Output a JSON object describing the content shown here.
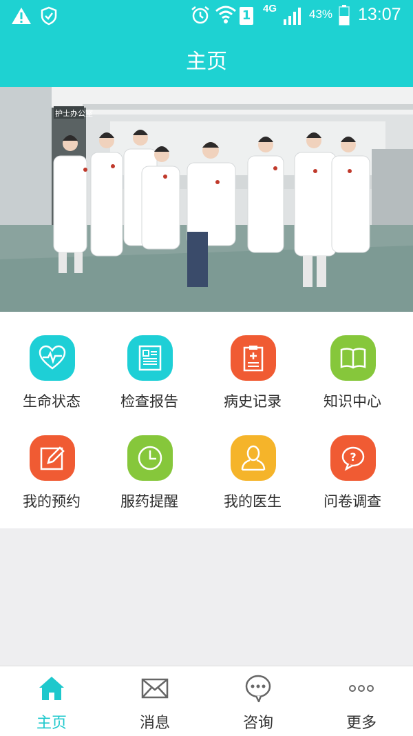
{
  "status_bar": {
    "network": "4G",
    "sim": "1",
    "battery": "43%",
    "time": "13:07",
    "icons": [
      "warning-icon",
      "shield-icon",
      "alarm-icon",
      "wifi-icon",
      "sim-icon",
      "signal-icon",
      "battery-icon"
    ]
  },
  "header": {
    "title": "主页"
  },
  "banner": {
    "description_icon": "team-photo",
    "sign_text": "护士办公室"
  },
  "grid": {
    "items": [
      {
        "label": "生命状态",
        "icon": "heartbeat-icon",
        "color": "#1ecfd6"
      },
      {
        "label": "检查报告",
        "icon": "report-icon",
        "color": "#1ecfd6"
      },
      {
        "label": "病史记录",
        "icon": "clipboard-icon",
        "color": "#f05b33"
      },
      {
        "label": "知识中心",
        "icon": "book-icon",
        "color": "#86c73b"
      },
      {
        "label": "我的预约",
        "icon": "edit-icon",
        "color": "#f05b33"
      },
      {
        "label": "服药提醒",
        "icon": "clock-icon",
        "color": "#86c73b"
      },
      {
        "label": "我的医生",
        "icon": "doctor-icon",
        "color": "#f5b42a"
      },
      {
        "label": "问卷调查",
        "icon": "question-icon",
        "color": "#f05b33"
      }
    ]
  },
  "bottom_nav": {
    "active_color": "#1ec8cc",
    "items": [
      {
        "label": "主页",
        "icon": "home-icon",
        "active": true
      },
      {
        "label": "消息",
        "icon": "mail-icon",
        "active": false
      },
      {
        "label": "咨询",
        "icon": "chat-icon",
        "active": false
      },
      {
        "label": "更多",
        "icon": "more-icon",
        "active": false
      }
    ]
  }
}
